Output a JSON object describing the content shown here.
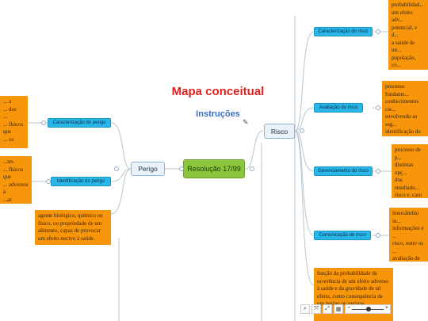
{
  "map": {
    "title": "Mapa conceitual",
    "subtitle": "Instruções",
    "note_icon": "note-icon",
    "central": "Resolução 17/99",
    "left": {
      "label": "Perigo",
      "children": [
        {
          "label": "Caracterização do perigo",
          "note": "... a\n... dos\n...\n... físicos que\n... os"
        },
        {
          "label": "Identificação do perigo",
          "note": "...tes\n... físicos que\n... adversos à\n...ar presentes\n...imento ou"
        }
      ],
      "note": "agente biológico, químico ou físico, ou propriedade de um alimento, capaz de provocar um efeito nocivo à saúde."
    },
    "right": {
      "label": "Risco",
      "children": [
        {
          "label": "Caracterização do risco",
          "note": "probabilidad...\num efeito adv...\npotencial, e d...\na saúde de un...\npopulação, co...\nidentificação ...\ncaracterização...\nexposição."
        },
        {
          "label": "Avaliação do risco",
          "note": "processo fundame...\nconhecimentos cie...\nenvolvendo as seg...\nidentificação do p...\ncaracterização do ...\navaliação da expos...\ncaracterização do ..."
        },
        {
          "label": "Gerenciamento do risco",
          "note": "processo de p...\ndistintas opç...\ndos resultado...\nrisco e, caso n...\ne aplicação d...\nde controle ap...\nas medidas da..."
        },
        {
          "label": "Comunicação do risco",
          "note": "intercâmbio in...\ninformações e ...\nrisco, entre os ...\navaliação de ri...\ngerenciamento ...\nconsumidores ...\ninteressadas (R..."
        }
      ],
      "note": "função da probabilidade de ocorrência de um efeito adverso à saúde e da gravidade de tal efeito, como consequência de um perigo ou perigos."
    }
  },
  "toolbar": {
    "search_icon": "search-icon",
    "fit_icon": "fit-icon",
    "expand_icon": "expand-icon",
    "grid_icon": "grid-icon",
    "zoom_level": 0.5
  },
  "colors": {
    "central": "#8cc63f",
    "main": "#eaf2fb",
    "sub": "#29b6e8",
    "note": "#f7950b",
    "title": "#e02020",
    "subtitle": "#3a6fc4"
  }
}
